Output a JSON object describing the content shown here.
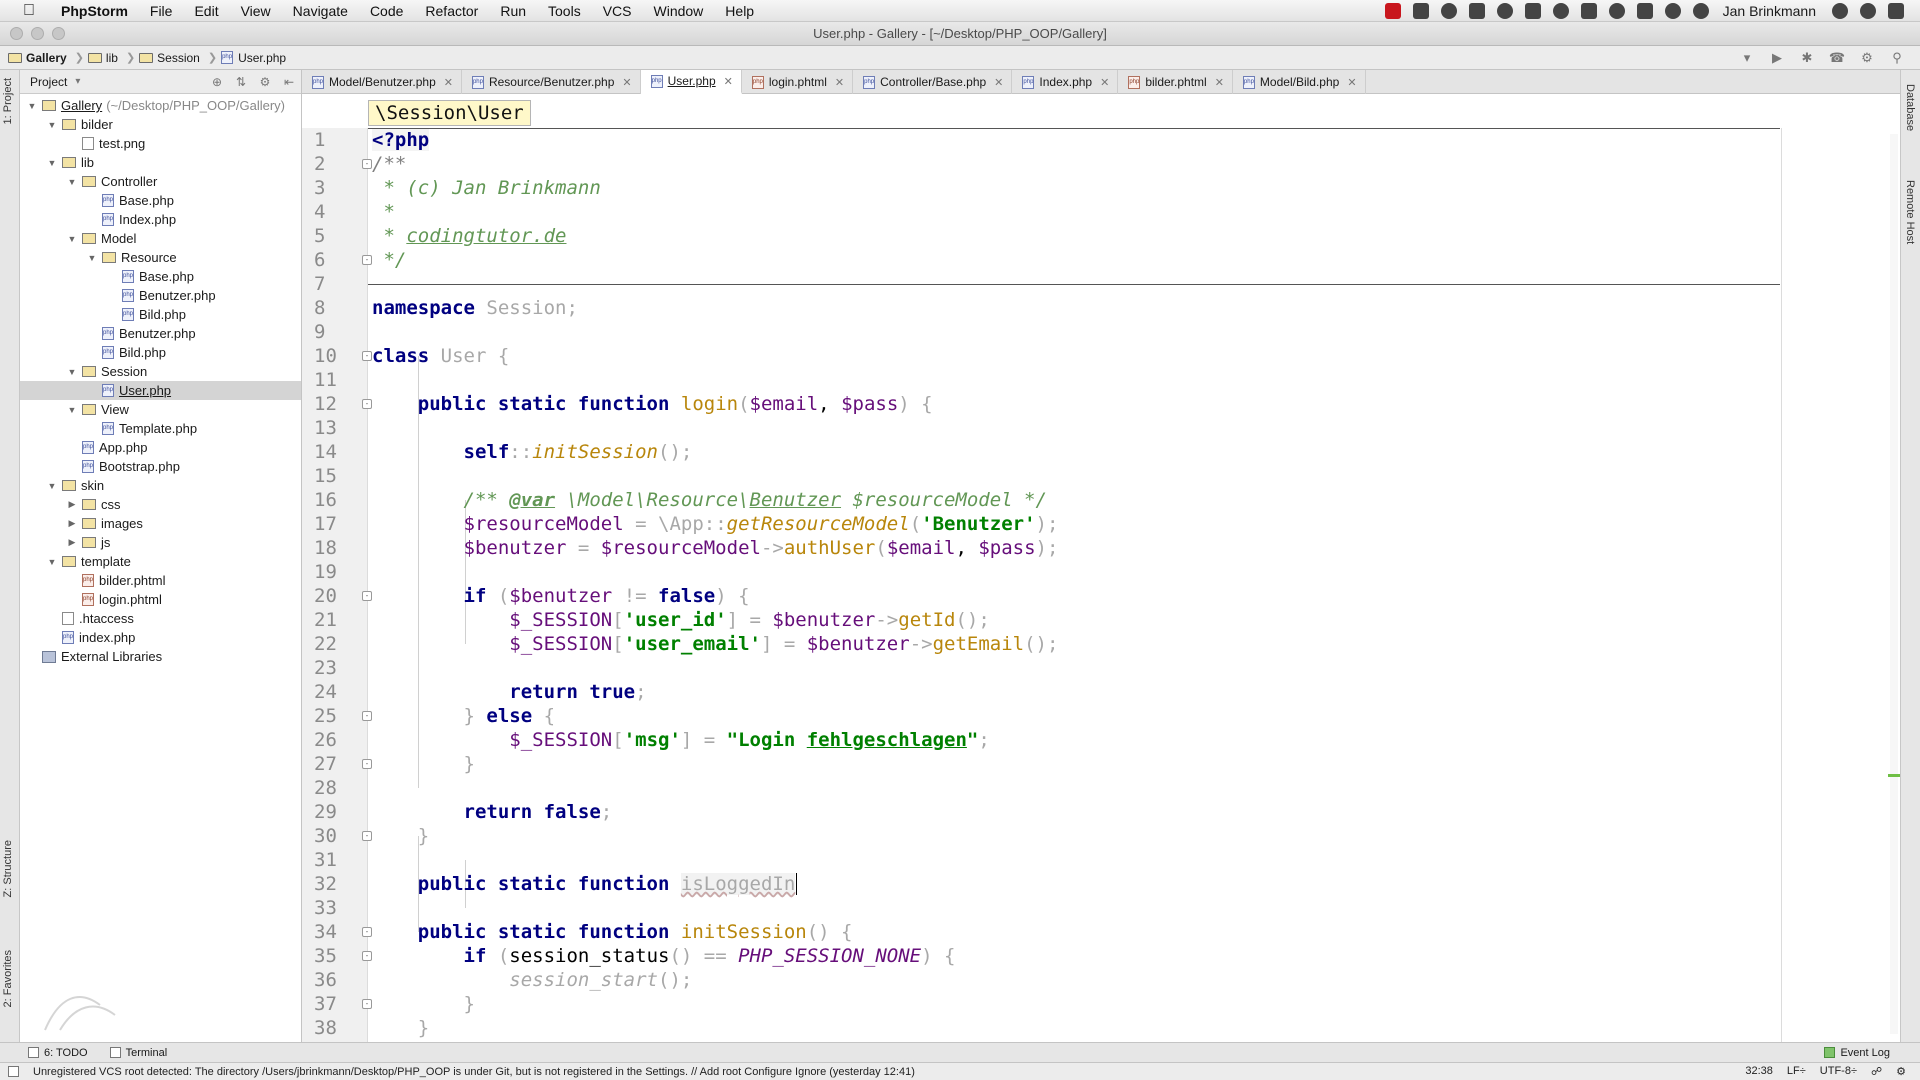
{
  "menubar": {
    "app": "PhpStorm",
    "items": [
      "File",
      "Edit",
      "View",
      "Navigate",
      "Code",
      "Refactor",
      "Run",
      "Tools",
      "VCS",
      "Window",
      "Help"
    ],
    "user": "Jan Brinkmann"
  },
  "window": {
    "title": "User.php - Gallery - [~/Desktop/PHP_OOP/Gallery]"
  },
  "breadcrumbs": [
    "Gallery",
    "lib",
    "Session",
    "User.php"
  ],
  "left_strip": {
    "project": "1: Project",
    "structure": "Z: Structure",
    "favorites": "2: Favorites"
  },
  "right_strip": {
    "database": "Database",
    "remote": "Remote Host"
  },
  "project_panel": {
    "title": "Project"
  },
  "tree": [
    {
      "label": "Gallery",
      "hint": "(~/Desktop/PHP_OOP/Gallery)",
      "depth": 0,
      "type": "folder",
      "open": true
    },
    {
      "label": "bilder",
      "depth": 1,
      "type": "folder",
      "open": true
    },
    {
      "label": "test.png",
      "depth": 2,
      "type": "file"
    },
    {
      "label": "lib",
      "depth": 1,
      "type": "folder",
      "open": true
    },
    {
      "label": "Controller",
      "depth": 2,
      "type": "folder",
      "open": true
    },
    {
      "label": "Base.php",
      "depth": 3,
      "type": "php"
    },
    {
      "label": "Index.php",
      "depth": 3,
      "type": "php"
    },
    {
      "label": "Model",
      "depth": 2,
      "type": "folder",
      "open": true
    },
    {
      "label": "Resource",
      "depth": 3,
      "type": "folder",
      "open": true
    },
    {
      "label": "Base.php",
      "depth": 4,
      "type": "php"
    },
    {
      "label": "Benutzer.php",
      "depth": 4,
      "type": "php"
    },
    {
      "label": "Bild.php",
      "depth": 4,
      "type": "php"
    },
    {
      "label": "Benutzer.php",
      "depth": 3,
      "type": "php"
    },
    {
      "label": "Bild.php",
      "depth": 3,
      "type": "php"
    },
    {
      "label": "Session",
      "depth": 2,
      "type": "folder",
      "open": true
    },
    {
      "label": "User.php",
      "depth": 3,
      "type": "php",
      "selected": true
    },
    {
      "label": "View",
      "depth": 2,
      "type": "folder",
      "open": true
    },
    {
      "label": "Template.php",
      "depth": 3,
      "type": "php"
    },
    {
      "label": "App.php",
      "depth": 2,
      "type": "php"
    },
    {
      "label": "Bootstrap.php",
      "depth": 2,
      "type": "php"
    },
    {
      "label": "skin",
      "depth": 1,
      "type": "folder",
      "open": true
    },
    {
      "label": "css",
      "depth": 2,
      "type": "folder",
      "open": false
    },
    {
      "label": "images",
      "depth": 2,
      "type": "folder",
      "open": false
    },
    {
      "label": "js",
      "depth": 2,
      "type": "folder",
      "open": false
    },
    {
      "label": "template",
      "depth": 1,
      "type": "folder",
      "open": true
    },
    {
      "label": "bilder.phtml",
      "depth": 2,
      "type": "phtml"
    },
    {
      "label": "login.phtml",
      "depth": 2,
      "type": "phtml"
    },
    {
      "label": ".htaccess",
      "depth": 1,
      "type": "file"
    },
    {
      "label": "index.php",
      "depth": 1,
      "type": "php"
    },
    {
      "label": "External Libraries",
      "depth": 0,
      "type": "lib"
    }
  ],
  "tabs": [
    {
      "label": "Model/Benutzer.php",
      "type": "php"
    },
    {
      "label": "Resource/Benutzer.php",
      "type": "php"
    },
    {
      "label": "User.php",
      "type": "php",
      "active": true
    },
    {
      "label": "login.phtml",
      "type": "phtml"
    },
    {
      "label": "Controller/Base.php",
      "type": "php"
    },
    {
      "label": "Index.php",
      "type": "php"
    },
    {
      "label": "bilder.phtml",
      "type": "phtml"
    },
    {
      "label": "Model/Bild.php",
      "type": "php"
    }
  ],
  "editor": {
    "namespace_crumb": "\\Session\\User",
    "line_numbers": [
      "1",
      "2",
      "3",
      "4",
      "5",
      "6",
      "7",
      "8",
      "9",
      "10",
      "11",
      "12",
      "13",
      "14",
      "15",
      "16",
      "17",
      "18",
      "19",
      "20",
      "21",
      "22",
      "23",
      "24",
      "25",
      "26",
      "27",
      "28",
      "29",
      "30",
      "31",
      "32",
      "33",
      "34",
      "35",
      "36",
      "37",
      "38"
    ],
    "lines": [
      [
        [
          "tag",
          "<?php"
        ]
      ],
      [
        [
          "com",
          "/**"
        ]
      ],
      [
        [
          "doccom",
          " * (c) Jan Brinkmann"
        ]
      ],
      [
        [
          "doccom",
          " *"
        ]
      ],
      [
        [
          "doccom",
          " * "
        ],
        [
          "docurl",
          "codingtutor.de"
        ]
      ],
      [
        [
          "doccom",
          " */"
        ]
      ],
      [],
      [
        [
          "kw",
          "namespace "
        ],
        [
          "ns",
          "Session"
        ],
        [
          "gray",
          ";"
        ]
      ],
      [],
      [
        [
          "kw",
          "class "
        ],
        [
          "ns",
          "User "
        ],
        [
          "gray",
          "{"
        ]
      ],
      [],
      [
        [
          "plain",
          "    "
        ],
        [
          "kw",
          "public static function "
        ],
        [
          "method",
          "login"
        ],
        [
          "gray",
          "("
        ],
        [
          "var",
          "$email"
        ],
        [
          "plain",
          ", "
        ],
        [
          "var",
          "$pass"
        ],
        [
          "gray",
          ") {"
        ]
      ],
      [],
      [
        [
          "plain",
          "        "
        ],
        [
          "kw",
          "self"
        ],
        [
          "gray",
          "::"
        ],
        [
          "italicm",
          "initSession"
        ],
        [
          "gray",
          "();"
        ]
      ],
      [],
      [
        [
          "plain",
          "        "
        ],
        [
          "doccom",
          "/** "
        ],
        [
          "doctag",
          "@var"
        ],
        [
          "doccom",
          " \\Model\\Resource\\"
        ],
        [
          "docul",
          "Benutzer"
        ],
        [
          "doccom",
          " $resourceModel */"
        ]
      ],
      [
        [
          "plain",
          "        "
        ],
        [
          "var",
          "$resourceModel"
        ],
        [
          "gray",
          " = "
        ],
        [
          "ns",
          "\\App"
        ],
        [
          "gray",
          "::"
        ],
        [
          "italicm",
          "getResourceModel"
        ],
        [
          "gray",
          "("
        ],
        [
          "str",
          "'Benutzer'"
        ],
        [
          "gray",
          ");"
        ]
      ],
      [
        [
          "plain",
          "        "
        ],
        [
          "var",
          "$benutzer"
        ],
        [
          "gray",
          " = "
        ],
        [
          "var",
          "$resourceModel"
        ],
        [
          "gray",
          "->"
        ],
        [
          "method",
          "authUser"
        ],
        [
          "gray",
          "("
        ],
        [
          "var",
          "$email"
        ],
        [
          "plain",
          ", "
        ],
        [
          "var",
          "$pass"
        ],
        [
          "gray",
          ");"
        ]
      ],
      [],
      [
        [
          "plain",
          "        "
        ],
        [
          "kw",
          "if "
        ],
        [
          "gray",
          "("
        ],
        [
          "var",
          "$benutzer"
        ],
        [
          "gray",
          " != "
        ],
        [
          "kw",
          "false"
        ],
        [
          "gray",
          ") {"
        ]
      ],
      [
        [
          "plain",
          "            "
        ],
        [
          "var",
          "$_SESSION"
        ],
        [
          "gray",
          "["
        ],
        [
          "str",
          "'user_id'"
        ],
        [
          "gray",
          "] = "
        ],
        [
          "var",
          "$benutzer"
        ],
        [
          "gray",
          "->"
        ],
        [
          "method",
          "getId"
        ],
        [
          "gray",
          "();"
        ]
      ],
      [
        [
          "plain",
          "            "
        ],
        [
          "var",
          "$_SESSION"
        ],
        [
          "gray",
          "["
        ],
        [
          "str",
          "'user_email'"
        ],
        [
          "gray",
          "] = "
        ],
        [
          "var",
          "$benutzer"
        ],
        [
          "gray",
          "->"
        ],
        [
          "method",
          "getEmail"
        ],
        [
          "gray",
          "();"
        ]
      ],
      [],
      [
        [
          "plain",
          "            "
        ],
        [
          "kw",
          "return true"
        ],
        [
          "gray",
          ";"
        ]
      ],
      [
        [
          "plain",
          "        "
        ],
        [
          "gray",
          "} "
        ],
        [
          "kw",
          "else "
        ],
        [
          "gray",
          "{"
        ]
      ],
      [
        [
          "plain",
          "            "
        ],
        [
          "var",
          "$_SESSION"
        ],
        [
          "gray",
          "["
        ],
        [
          "str",
          "'msg'"
        ],
        [
          "gray",
          "] = "
        ],
        [
          "str",
          "\"Login "
        ],
        [
          "strul",
          "fehlgeschlagen"
        ],
        [
          "str",
          "\""
        ],
        [
          "gray",
          ";"
        ]
      ],
      [
        [
          "plain",
          "        "
        ],
        [
          "gray",
          "}"
        ]
      ],
      [],
      [
        [
          "plain",
          "        "
        ],
        [
          "kw",
          "return false"
        ],
        [
          "gray",
          ";"
        ]
      ],
      [
        [
          "plain",
          "    "
        ],
        [
          "gray",
          "}"
        ]
      ],
      [],
      [
        [
          "plain",
          "    "
        ],
        [
          "kw",
          "public static function "
        ],
        [
          "sq",
          "isLoggedIn"
        ]
      ],
      [],
      [
        [
          "plain",
          "    "
        ],
        [
          "kw",
          "public static function "
        ],
        [
          "method",
          "initSession"
        ],
        [
          "gray",
          "() {"
        ]
      ],
      [
        [
          "plain",
          "        "
        ],
        [
          "kw",
          "if "
        ],
        [
          "gray",
          "("
        ],
        [
          "fnc",
          "session_status"
        ],
        [
          "gray",
          "() == "
        ],
        [
          "const",
          "PHP_SESSION_NONE"
        ],
        [
          "gray",
          ") {"
        ]
      ],
      [
        [
          "plain",
          "            "
        ],
        [
          "italicfn",
          "session_start"
        ],
        [
          "gray",
          "();"
        ]
      ],
      [
        [
          "plain",
          "        "
        ],
        [
          "gray",
          "}"
        ]
      ],
      [
        [
          "plain",
          "    "
        ],
        [
          "gray",
          "}"
        ]
      ]
    ]
  },
  "bottom_tabs": {
    "todo": "6: TODO",
    "terminal": "Terminal",
    "event_log": "Event Log"
  },
  "statusbar": {
    "message": "Unregistered VCS root detected: The directory /Users/jbrinkmann/Desktop/PHP_OOP is under Git, but is not registered in the Settings. // Add root  Configure  Ignore (yesterday 12:41)",
    "position": "32:38",
    "line_sep": "LF÷",
    "encoding": "UTF-8÷"
  }
}
